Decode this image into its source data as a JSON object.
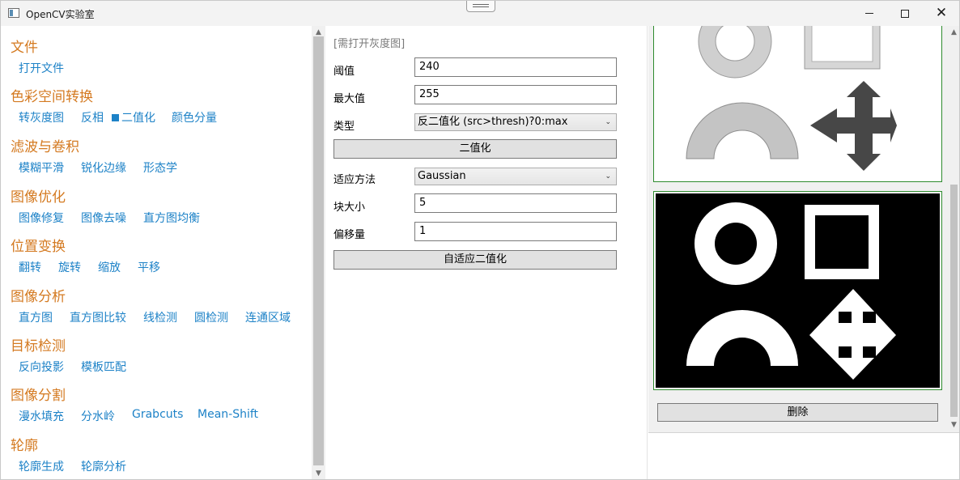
{
  "window": {
    "title": "OpenCV实验室",
    "minimize": "–",
    "maximize": "□",
    "close": "✕"
  },
  "nav": {
    "sections": [
      {
        "category": "文件",
        "items": [
          "打开文件"
        ]
      },
      {
        "category": "色彩空间转换",
        "items": [
          "转灰度图",
          "反相",
          "二值化",
          "颜色分量"
        ],
        "active": "二值化"
      },
      {
        "category": "滤波与卷积",
        "items": [
          "模糊平滑",
          "锐化边缘",
          "形态学"
        ]
      },
      {
        "category": "图像优化",
        "items": [
          "图像修复",
          "图像去噪",
          "直方图均衡"
        ]
      },
      {
        "category": "位置变换",
        "items": [
          "翻转",
          "旋转",
          "缩放",
          "平移"
        ]
      },
      {
        "category": "图像分析",
        "items": [
          "直方图",
          "直方图比较",
          "线检测",
          "圆检测",
          "连通区域"
        ]
      },
      {
        "category": "目标检测",
        "items": [
          "反向投影",
          "模板匹配"
        ]
      },
      {
        "category": "图像分割",
        "items": [
          "漫水填充",
          "分水岭",
          "Grabcuts",
          "Mean-Shift"
        ]
      },
      {
        "category": "轮廓",
        "items": [
          "轮廓生成",
          "轮廓分析"
        ]
      }
    ]
  },
  "form": {
    "hint": "[需打开灰度图]",
    "threshold_label": "阈值",
    "threshold_value": "240",
    "max_label": "最大值",
    "max_value": "255",
    "type_label": "类型",
    "type_value": "反二值化 (src>thresh)?0:max",
    "binarize_button": "二值化",
    "adaptive_method_label": "适应方法",
    "adaptive_method_value": "Gaussian",
    "block_size_label": "块大小",
    "block_size_value": "5",
    "offset_label": "偏移量",
    "offset_value": "1",
    "adaptive_button": "自适应二值化"
  },
  "images": {
    "delete_button": "删除"
  },
  "colors": {
    "category": "#d47a21",
    "link": "#1d82c7",
    "frame": "#2e8b2e"
  }
}
